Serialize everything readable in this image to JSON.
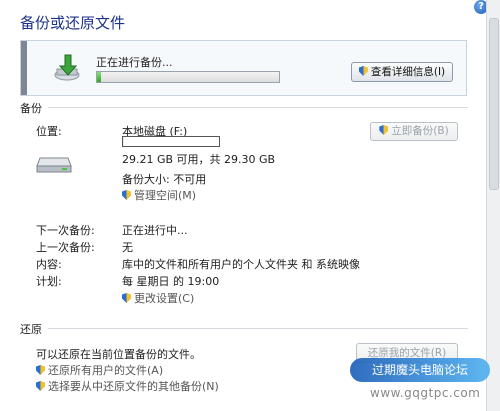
{
  "window": {
    "title": "备份或还原文件",
    "help_glyph": "?"
  },
  "progress": {
    "label": "正在进行备份...",
    "percent": 2,
    "details_button": "查看详细信息(I)"
  },
  "backup": {
    "section_title": "备份",
    "location_label": "位置:",
    "location_value": "本地磁盘 (F:)",
    "capacity_used_fraction": 0.003,
    "capacity_text": "29.21 GB 可用，共 29.30 GB",
    "backup_size": "备份大小: 不可用",
    "manage_space_link": "管理空间(M)",
    "backup_now_button": "立即备份(B)",
    "next_label": "下一次备份:",
    "next_value": "正在进行中...",
    "last_label": "上一次备份:",
    "last_value": "无",
    "content_label": "内容:",
    "content_value": "库中的文件和所有用户的个人文件夹 和 系统映像",
    "schedule_label": "计划:",
    "schedule_value": "每 星期日 的 19:00",
    "change_settings_link": "更改设置(C)"
  },
  "restore": {
    "section_title": "还原",
    "description": "可以还原在当前位置备份的文件。",
    "restore_all_users_link": "还原所有用户的文件(A)",
    "select_other_backup_link": "选择要从中还原文件的其他备份(N)",
    "restore_button": "还原我的文件(R)"
  },
  "watermark": {
    "badge": "过期魔头电脑论坛",
    "url": "www.gqgtpc.com"
  },
  "colors": {
    "title": "#1e3287",
    "progress_fill": "#2fa61f"
  }
}
